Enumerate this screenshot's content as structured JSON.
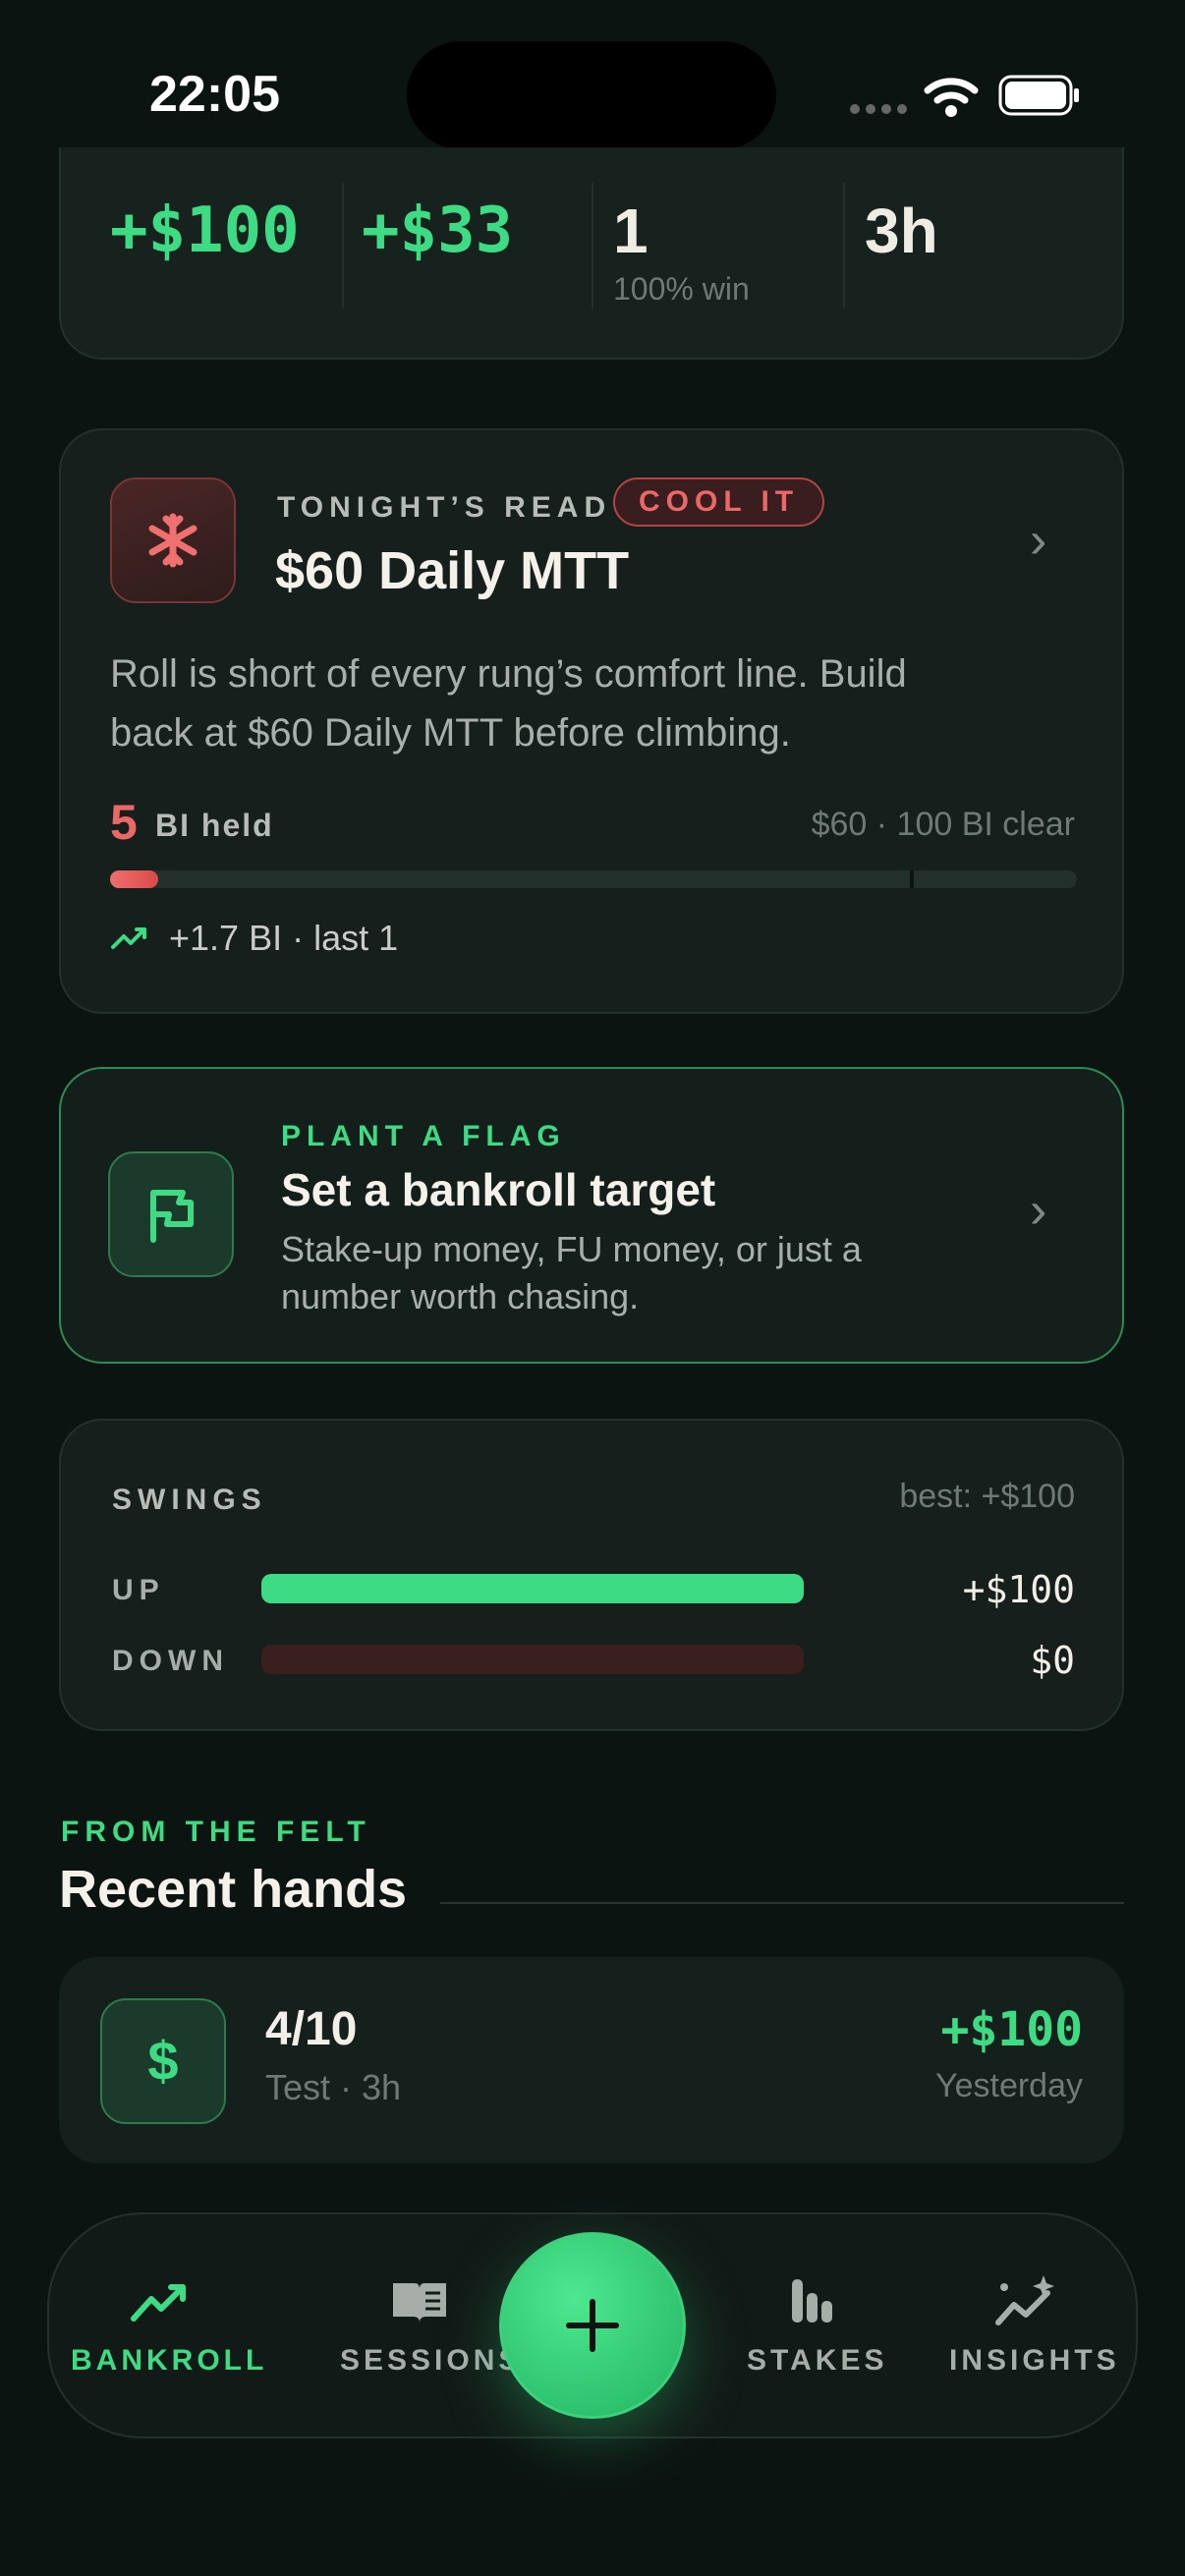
{
  "status_bar": {
    "time": "22:05"
  },
  "stats": [
    {
      "value": "+$100",
      "sub": ""
    },
    {
      "value": "+$33",
      "sub": ""
    },
    {
      "value": "1",
      "sub": "100% win"
    },
    {
      "value": "3h",
      "sub": ""
    }
  ],
  "read_card": {
    "eyebrow": "TONIGHT’S READ",
    "badge": "COOL IT",
    "title": "$60 Daily MTT",
    "body_line1": "Roll is short of every rung’s comfort line. Build",
    "body_line2": "back at $60 Daily MTT before climbing.",
    "bi_count": "5",
    "bi_label": "BI held",
    "target": "$60 · 100 BI clear",
    "progress": 0.05,
    "trend": "+1.7 BI · last 1",
    "colors": {
      "accent": "#ec6868"
    }
  },
  "flag_card": {
    "eyebrow": "PLANT A FLAG",
    "title": "Set a bankroll target",
    "body_line1": "Stake-up money, FU money, or just a",
    "body_line2": "number worth chasing."
  },
  "swings": {
    "title": "SWINGS",
    "best": "best: +$100",
    "up_label": "UP",
    "up_value": "+$100",
    "up_fill": 1.0,
    "down_label": "DOWN",
    "down_value": "$0",
    "down_fill": 0.0
  },
  "recent": {
    "eyebrow": "FROM THE FELT",
    "title": "Recent hands",
    "items": [
      {
        "title": "4/10",
        "sub": "Test · 3h",
        "amount": "+$100",
        "when": "Yesterday",
        "icon": "dollar-icon"
      }
    ]
  },
  "nav": {
    "items": [
      {
        "label": "BANKROLL",
        "icon": "chart-line-icon",
        "active": true
      },
      {
        "label": "SESSIONS",
        "icon": "book-icon",
        "active": false
      },
      {
        "label": "STAKES",
        "icon": "stack-icon",
        "active": false
      },
      {
        "label": "INSIGHTS",
        "icon": "sparkle-chart-icon",
        "active": false
      }
    ],
    "add_icon": "plus-icon"
  },
  "colors": {
    "green": "#3ddc84",
    "red": "#ec6868",
    "bg": "#0c1412"
  }
}
